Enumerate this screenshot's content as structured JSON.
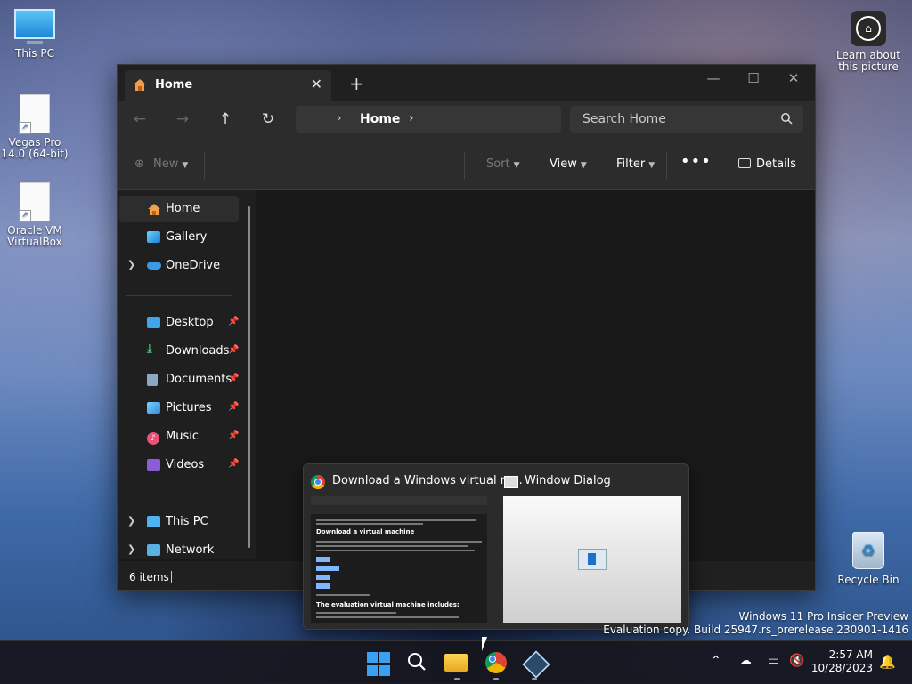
{
  "desktop": {
    "icons": [
      {
        "label": "This PC"
      },
      {
        "label": "Vegas Pro 14.0 (64-bit)"
      },
      {
        "label": "Oracle VM VirtualBox"
      },
      {
        "label": "Learn about this picture"
      },
      {
        "label": "Recycle Bin"
      }
    ],
    "watermark": {
      "line1": "Windows 11 Pro Insider Preview",
      "line2": "Evaluation copy. Build 25947.rs_prerelease.230901-1416"
    }
  },
  "explorer": {
    "tab_title": "Home",
    "address": {
      "crumb": "Home"
    },
    "search_placeholder": "Search Home",
    "toolbar": {
      "new_label": "New",
      "sort_label": "Sort",
      "view_label": "View",
      "filter_label": "Filter",
      "details_label": "Details"
    },
    "sidebar": {
      "items": [
        {
          "label": "Home",
          "icon": "home-icon",
          "selected": true
        },
        {
          "label": "Gallery",
          "icon": "gallery-icon"
        },
        {
          "label": "OneDrive",
          "icon": "onedrive-icon",
          "expandable": true
        },
        {
          "label": "Desktop",
          "icon": "desktop-icon",
          "pinned": true
        },
        {
          "label": "Downloads",
          "icon": "download-icon",
          "pinned": true
        },
        {
          "label": "Documents",
          "icon": "documents-icon",
          "pinned": true
        },
        {
          "label": "Pictures",
          "icon": "pictures-icon",
          "pinned": true
        },
        {
          "label": "Music",
          "icon": "music-icon",
          "pinned": true
        },
        {
          "label": "Videos",
          "icon": "videos-icon",
          "pinned": true
        },
        {
          "label": "This PC",
          "icon": "pc-icon",
          "expandable": true
        },
        {
          "label": "Network",
          "icon": "network-icon",
          "expandable": true
        }
      ]
    },
    "status": {
      "items_count": "6 items"
    }
  },
  "thumbnails": {
    "chrome_title": "Download a Windows virtual m...",
    "dialog_title": "Window Dialog",
    "preview_heading1": "Download a virtual machine",
    "preview_heading2": "The evaluation virtual machine includes:"
  },
  "taskbar": {
    "time": "2:57 AM",
    "date": "10/28/2023"
  }
}
